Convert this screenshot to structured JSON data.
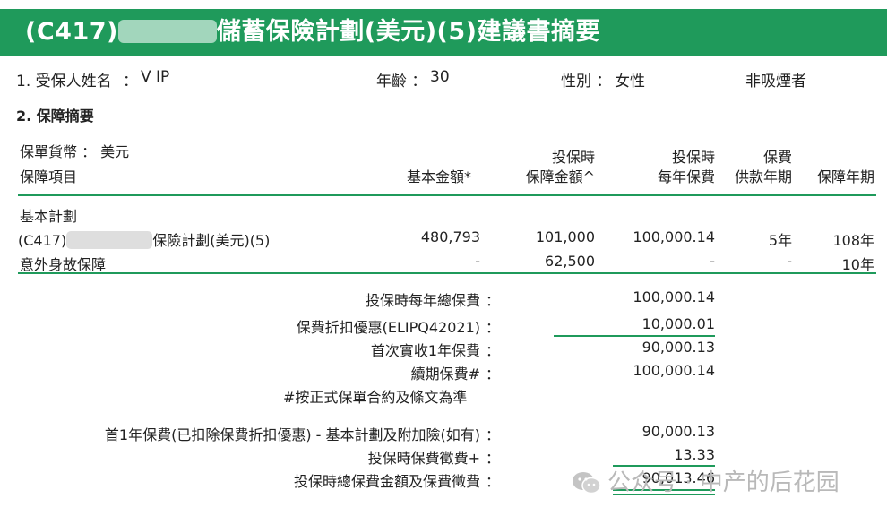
{
  "header": {
    "title_prefix": "(C417)",
    "title_suffix": "儲蓄保險計劃(美元)(5)建議書摘要"
  },
  "insured": {
    "section": "1. 受保人姓名",
    "colon": "：",
    "name": "V IP",
    "age_label": "年齡 ：",
    "age": "30",
    "gender_label": "性別 ：",
    "gender": "女性",
    "smoker": "非吸煙者"
  },
  "summary": {
    "section": "2. 保障摘要",
    "currency_label": "保單貨幣 ： 美元",
    "item_label": "保障項目",
    "columns": {
      "basic_amount": "基本金額*",
      "coverage_l1": "投保時",
      "coverage_l2": "保障金額^",
      "premium_l1": "投保時",
      "premium_l2": "每年保費",
      "term_l1": "保費",
      "term_l2": "供款年期",
      "period": "保障年期"
    },
    "basic_plan_label": "基本計劃",
    "rows": [
      {
        "name_prefix": "(C417)",
        "name_suffix": "保險計劃(美元)(5)",
        "basic": "480,793",
        "coverage": "101,000",
        "premium": "100,000.14",
        "term": "5年",
        "period": "108年"
      },
      {
        "name": "意外身故保障",
        "basic": "-",
        "coverage": "62,500",
        "premium": "-",
        "term": "-",
        "period": "10年"
      }
    ]
  },
  "totals": [
    {
      "label": "投保時每年總保費",
      "colon": "：",
      "value": "100,000.14"
    },
    {
      "label": "保費折扣優惠(ELIPQ42021)",
      "colon": "：",
      "value": "10,000.01"
    },
    {
      "label": "首次實收1年保費",
      "colon": "：",
      "value": "90,000.13"
    },
    {
      "label": "續期保費#",
      "colon": "：",
      "value": "100,000.14"
    }
  ],
  "note": "#按正式保單合約及條文為準",
  "final": [
    {
      "label": "首1年保費(已扣除保費折扣優惠) - 基本計劃及附加險(如有)",
      "colon": "：",
      "value": "90,000.13"
    },
    {
      "label": "投保時保費徵費+",
      "colon": "：",
      "value": "13.33"
    },
    {
      "label": "投保時總保費金額及保費徵費",
      "colon": "：",
      "value": "90,013.46"
    }
  ],
  "watermark": {
    "text": "公众号 · 中产的后花园",
    "icon": "wechat-icon"
  },
  "colors": {
    "brand_green": "#1f9a5b"
  }
}
